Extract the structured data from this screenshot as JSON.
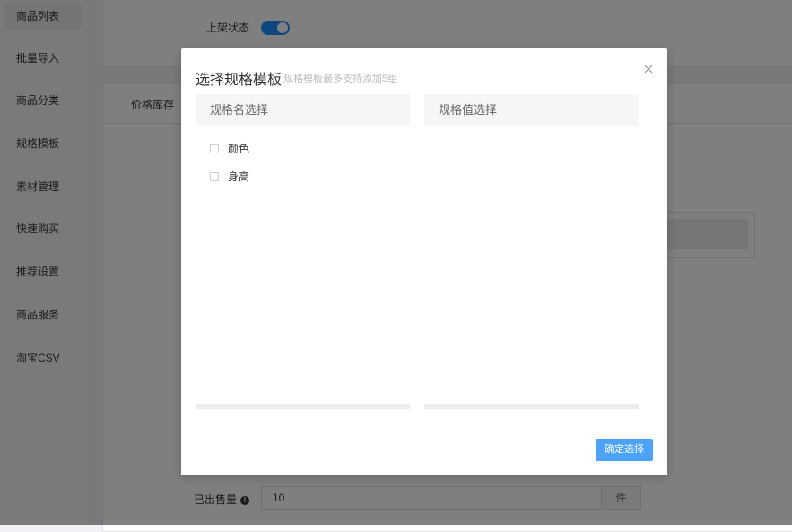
{
  "sidebar": {
    "items": [
      {
        "label": "商品列表"
      },
      {
        "label": "批量导入"
      },
      {
        "label": "商品分类"
      },
      {
        "label": "规格模板"
      },
      {
        "label": "素材管理"
      },
      {
        "label": "快速购买"
      },
      {
        "label": "推荐设置"
      },
      {
        "label": "商品服务"
      },
      {
        "label": "淘宝CSV"
      }
    ]
  },
  "main": {
    "shelf_status_label": "上架状态",
    "shelf_status_on": true,
    "tab_price_stock": "价格库存",
    "sold_label": "已出售量",
    "sold_value": "10",
    "sold_unit": "件"
  },
  "dialog": {
    "title": "选择规格模板",
    "subtitle": "规格模板最多支持添加5组",
    "close_icon": "close-icon",
    "spec_name_header": "规格名选择",
    "spec_value_header": "规格值选择",
    "spec_names": [
      {
        "label": "颜色",
        "checked": false
      },
      {
        "label": "身高",
        "checked": false
      }
    ],
    "confirm_label": "确定选择",
    "accent_color": "#4aa3ff"
  }
}
